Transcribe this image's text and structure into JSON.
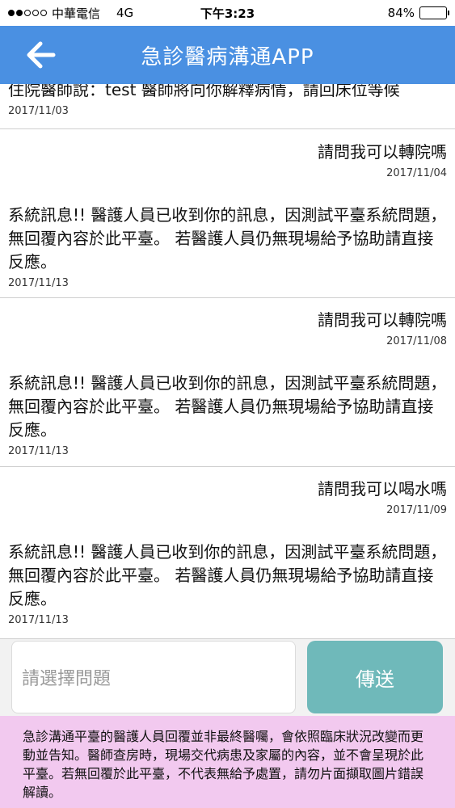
{
  "status_bar": {
    "carrier": "中華電信",
    "network": "4G",
    "time": "下午3:23",
    "battery": "84%",
    "battery_level": 0.84
  },
  "header": {
    "title": "急診醫病溝通APP"
  },
  "messages": [
    {
      "side": "left",
      "text": "住院醫師說：test 醫師將向你解釋病情，請回床位等候",
      "time": "2017/11/03"
    },
    {
      "side": "right",
      "text": "請問我可以轉院嗎",
      "time": "2017/11/04"
    },
    {
      "side": "left",
      "text": "系統訊息!! 醫護人員已收到你的訊息，因測試平臺系統問題，無回覆內容於此平臺。 若醫護人員仍無現場給予協助請直接反應。",
      "time": "2017/11/13"
    },
    {
      "side": "right",
      "text": "請問我可以轉院嗎",
      "time": "2017/11/08"
    },
    {
      "side": "left",
      "text": "系統訊息!! 醫護人員已收到你的訊息，因測試平臺系統問題，無回覆內容於此平臺。 若醫護人員仍無現場給予協助請直接反應。",
      "time": "2017/11/13"
    },
    {
      "side": "right",
      "text": "請問我可以喝水嗎",
      "time": "2017/11/09"
    },
    {
      "side": "left",
      "text": "系統訊息!! 醫護人員已收到你的訊息，因測試平臺系統問題，無回覆內容於此平臺。 若醫護人員仍無現場給予協助請直接反應。",
      "time": "2017/11/13"
    }
  ],
  "composer": {
    "select_placeholder": "請選擇問題",
    "send_label": "傳送"
  },
  "disclaimer": {
    "text": "急診溝通平臺的醫護人員回覆並非最終醫囑，會依照臨床狀況改變而更動並告知。醫師查房時，現場交代病患及家屬的內容，並不會呈現於此平臺。若無回覆於此平臺，不代表無給予處置，請勿片面擷取圖片錯誤解讀。"
  },
  "colors": {
    "header": "#4a90e2",
    "send_button": "#6fb9ba",
    "disclaimer_bg": "#f2c9ef"
  }
}
